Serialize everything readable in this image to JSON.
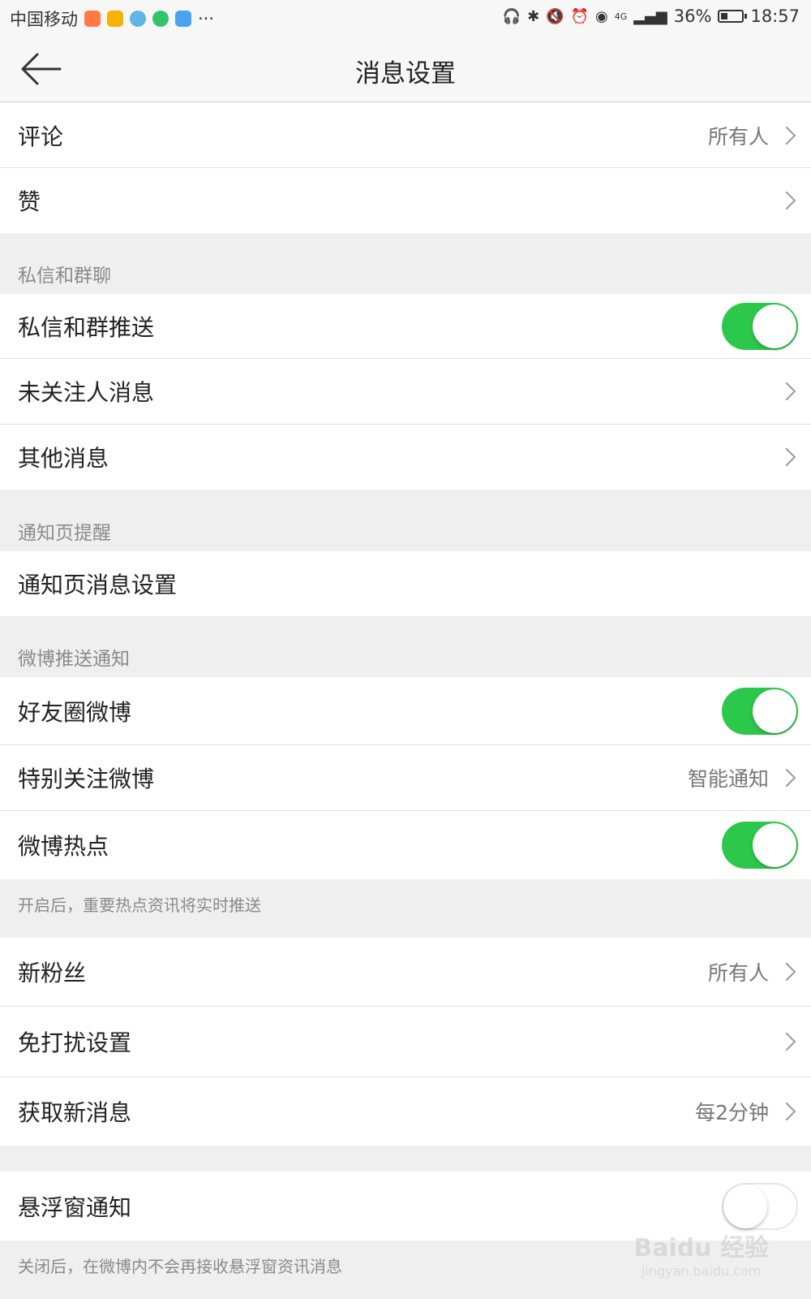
{
  "status_bar": {
    "carrier": "中国移动",
    "network": "4G",
    "battery": "36%",
    "time": "18:57",
    "more": "···"
  },
  "header": {
    "title": "消息设置"
  },
  "group1": {
    "comments": {
      "label": "评论",
      "value": "所有人"
    },
    "likes": {
      "label": "赞"
    }
  },
  "messages_section": {
    "header": "私信和群聊",
    "push": {
      "label": "私信和群推送",
      "enabled": true
    },
    "unfollowed": {
      "label": "未关注人消息"
    },
    "other": {
      "label": "其他消息"
    }
  },
  "notification_section": {
    "header": "通知页提醒",
    "settings": {
      "label": "通知页消息设置"
    }
  },
  "weibo_push_section": {
    "header": "微博推送通知",
    "friends": {
      "label": "好友圈微博",
      "enabled": true
    },
    "special": {
      "label": "特别关注微博",
      "value": "智能通知"
    },
    "hot": {
      "label": "微博热点",
      "enabled": true
    },
    "hot_note": "开启后，重要热点资讯将实时推送"
  },
  "group_misc": {
    "fans": {
      "label": "新粉丝",
      "value": "所有人"
    },
    "dnd": {
      "label": "免打扰设置"
    },
    "fetch": {
      "label": "获取新消息",
      "value": "每2分钟"
    }
  },
  "floating": {
    "label": "悬浮窗通知",
    "enabled": false,
    "note": "关闭后，在微博内不会再接收悬浮窗资讯消息"
  },
  "watermark": {
    "brand": "Baidu 经验",
    "url": "jingyan.baidu.com"
  },
  "colors": {
    "toggle_on": "#2cc84b",
    "background": "#efefef",
    "row": "#ffffff"
  }
}
